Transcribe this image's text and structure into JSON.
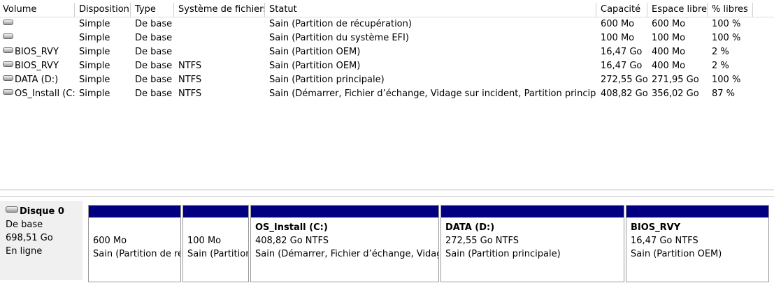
{
  "columns": [
    "Volume",
    "Disposition",
    "Type",
    "Système de fichiers",
    "Statut",
    "Capacité",
    "Espace libre",
    "% libres"
  ],
  "volumes": [
    {
      "volume": "",
      "disposition": "Simple",
      "type": "De base",
      "fs": "",
      "status": "Sain (Partition de récupération)",
      "capacity": "600 Mo",
      "free": "600 Mo",
      "pct": "100 %"
    },
    {
      "volume": "",
      "disposition": "Simple",
      "type": "De base",
      "fs": "",
      "status": "Sain (Partition du système EFI)",
      "capacity": "100 Mo",
      "free": "100 Mo",
      "pct": "100 %"
    },
    {
      "volume": "BIOS_RVY",
      "disposition": "Simple",
      "type": "De base",
      "fs": "",
      "status": "Sain (Partition OEM)",
      "capacity": "16,47 Go",
      "free": "400 Mo",
      "pct": "2 %"
    },
    {
      "volume": "BIOS_RVY",
      "disposition": "Simple",
      "type": "De base",
      "fs": "NTFS",
      "status": "Sain (Partition OEM)",
      "capacity": "16,47 Go",
      "free": "400 Mo",
      "pct": "2 %"
    },
    {
      "volume": "DATA (D:)",
      "disposition": "Simple",
      "type": "De base",
      "fs": "NTFS",
      "status": "Sain (Partition principale)",
      "capacity": "272,55 Go",
      "free": "271,95 Go",
      "pct": "100 %"
    },
    {
      "volume": "OS_Install (C:)",
      "disposition": "Simple",
      "type": "De base",
      "fs": "NTFS",
      "status": "Sain (Démarrer, Fichier d’échange, Vidage sur incident, Partition principale)",
      "capacity": "408,82 Go",
      "free": "356,02 Go",
      "pct": "87 %"
    }
  ],
  "disk": {
    "name": "Disque 0",
    "type": "De base",
    "size": "698,51 Go",
    "state": "En ligne"
  },
  "partitions": [
    {
      "title": "",
      "size": "600 Mo",
      "status": "Sain (Partition de récupération)"
    },
    {
      "title": "",
      "size": "100 Mo",
      "status": "Sain (Partition du système EFI)"
    },
    {
      "title": "OS_Install  (C:)",
      "size": "408,82 Go NTFS",
      "status": "Sain (Démarrer, Fichier d’échange, Vidage sur incident, Partition principale)"
    },
    {
      "title": "DATA  (D:)",
      "size": "272,55 Go NTFS",
      "status": "Sain (Partition principale)"
    },
    {
      "title": "BIOS_RVY",
      "size": "16,47 Go NTFS",
      "status": "Sain (Partition OEM)"
    }
  ],
  "colors": {
    "primary_partition_bar": "#000080",
    "disk_label_bg": "#f0f0f0"
  },
  "icons": {
    "volume": "drive-icon",
    "disk": "disk-drive-icon"
  }
}
